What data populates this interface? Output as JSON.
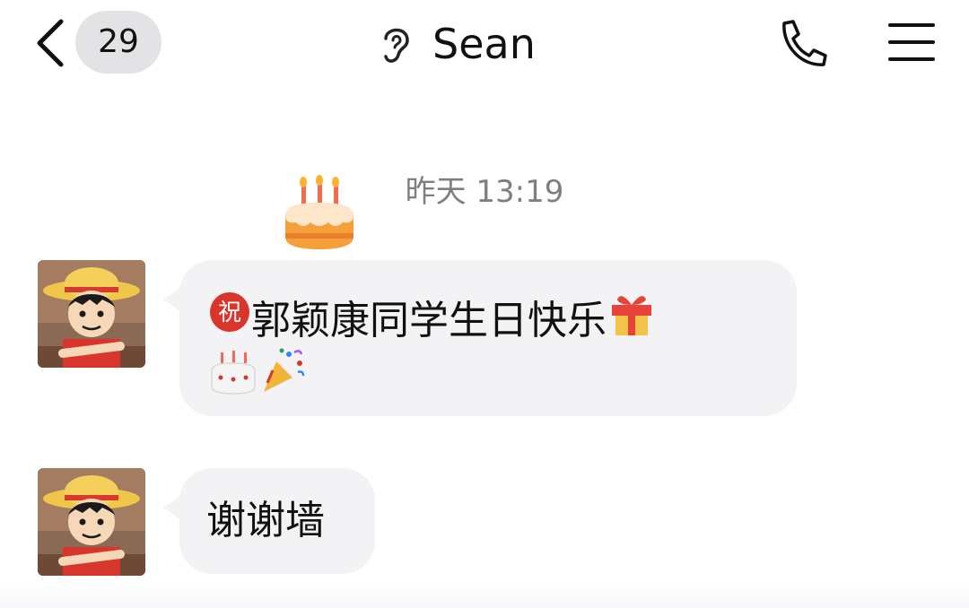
{
  "header": {
    "unread_count": "29",
    "contact_name": "Sean",
    "icons": {
      "back": "chevron-left-icon",
      "mode": "ear-icon",
      "call": "phone-icon",
      "menu": "hamburger-menu-icon"
    }
  },
  "chat": {
    "timestamp": "昨天 13:19",
    "messages": [
      {
        "sender": "Sean",
        "text": "郭颖康同学生日快乐",
        "emojis_before": [
          "祝"
        ],
        "emojis_after": [
          "gift-icon",
          "cake-icon",
          "party-popper-icon"
        ]
      },
      {
        "sender": "Sean",
        "text": "谢谢墙"
      }
    ]
  },
  "colors": {
    "bubble_bg": "#f3f3f6",
    "badge_bg": "#e3e3e6",
    "timestamp": "#7f7f7f",
    "zhu_red": "#d9362b"
  }
}
